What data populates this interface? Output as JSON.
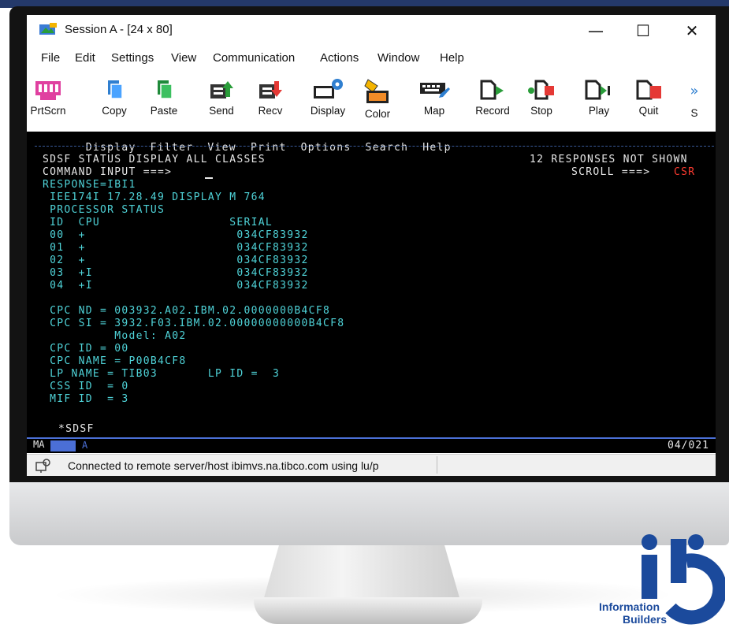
{
  "window": {
    "title": "Session A - [24 x 80]",
    "minimize": "—",
    "maximize": "☐",
    "close": "✕"
  },
  "menu": [
    "File",
    "Edit",
    "Settings",
    "View",
    "Communication",
    "Actions",
    "Window",
    "Help"
  ],
  "toolbar": [
    "PrtScrn",
    "Copy",
    "Paste",
    "Send",
    "Recv",
    "Display",
    "Color",
    "Map",
    "Record",
    "Stop",
    "Play",
    "Quit",
    "S"
  ],
  "toolbar_more": "»",
  "terminal": {
    "menu": [
      "Display",
      "Filter",
      "View",
      "Print",
      "Options",
      "Search",
      "Help"
    ],
    "header_left": "SDSF STATUS DISPLAY ALL CLASSES",
    "header_right": "12 RESPONSES NOT SHOWN",
    "command_label": "COMMAND INPUT ===>",
    "scroll_label": "SCROLL ===>",
    "scroll_value": "CSR",
    "response": "RESPONSE=IBI1",
    "lines": [
      " IEE174I 17.28.49 DISPLAY M 764",
      " PROCESSOR STATUS",
      " ID  CPU                  SERIAL",
      " 00  +                     034CF83932",
      " 01  +                     034CF83932",
      " 02  +                     034CF83932",
      " 03  +I                    034CF83932",
      " 04  +I                    034CF83932",
      "",
      " CPC ND = 003932.A02.IBM.02.0000000B4CF8",
      " CPC SI = 3932.F03.IBM.02.00000000000B4CF8",
      "          Model: A02",
      " CPC ID = 00",
      " CPC NAME = P00B4CF8",
      " LP NAME = TIB03       LP ID =  3",
      " CSS ID  = 0",
      " MIF ID  = 3"
    ],
    "footer": "*SDSF",
    "oia_left": "MA",
    "oia_mode": "A",
    "oia_cursor": "04/021"
  },
  "status": "Connected to remote server/host ibimvs.na.tibco.com using lu/p",
  "logo": {
    "line1": "Information",
    "line2": "Builders",
    "color": "#1b4a9c"
  }
}
